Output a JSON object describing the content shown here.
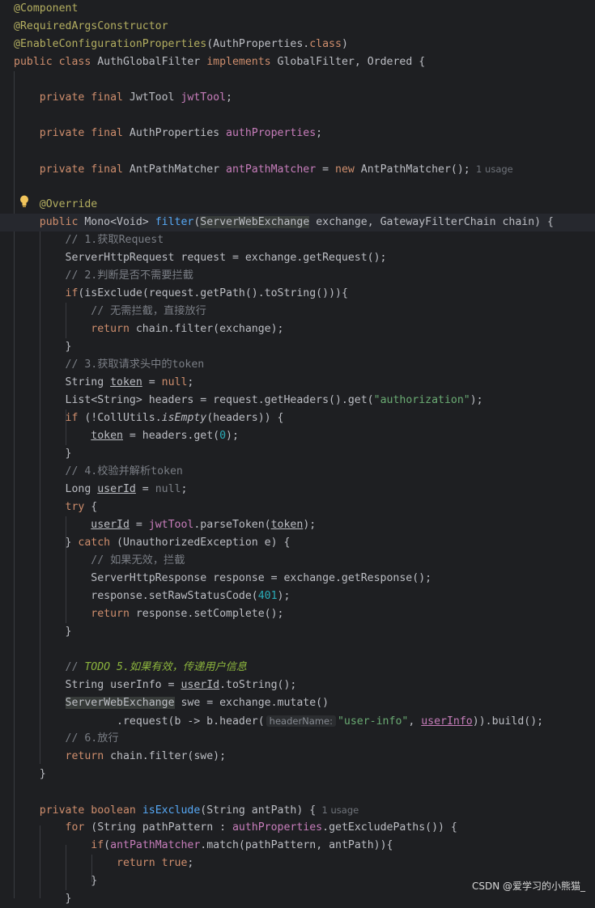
{
  "editor": {
    "lines": [
      [
        {
          "t": "@Component",
          "c": "ann"
        }
      ],
      [
        {
          "t": "@RequiredArgsConstructor",
          "c": "ann"
        }
      ],
      [
        {
          "t": "@EnableConfigurationProperties",
          "c": "ann"
        },
        {
          "t": "(AuthProperties."
        },
        {
          "t": "class",
          "c": "kw"
        },
        {
          "t": ")"
        }
      ],
      [
        {
          "t": "public class ",
          "c": "kw"
        },
        {
          "t": "AuthGlobalFilter "
        },
        {
          "t": "implements ",
          "c": "kw"
        },
        {
          "t": "GlobalFilter, Ordered {"
        }
      ],
      [],
      [
        {
          "t": "    "
        },
        {
          "t": "private final ",
          "c": "kw"
        },
        {
          "t": "JwtTool "
        },
        {
          "t": "jwtTool",
          "c": "fld"
        },
        {
          "t": ";"
        }
      ],
      [],
      [
        {
          "t": "    "
        },
        {
          "t": "private final ",
          "c": "kw"
        },
        {
          "t": "AuthProperties "
        },
        {
          "t": "authProperties",
          "c": "fld"
        },
        {
          "t": ";"
        }
      ],
      [],
      [
        {
          "t": "    "
        },
        {
          "t": "private final ",
          "c": "kw"
        },
        {
          "t": "AntPathMatcher "
        },
        {
          "t": "antPathMatcher",
          "c": "fld"
        },
        {
          "t": " = "
        },
        {
          "t": "new ",
          "c": "kw"
        },
        {
          "t": "AntPathMatcher();"
        },
        {
          "t": "  1 usage",
          "c": "hint"
        }
      ],
      [],
      [
        {
          "t": "    "
        },
        {
          "t": "@Override",
          "c": "ann"
        }
      ],
      [
        {
          "t": "    "
        },
        {
          "t": "public ",
          "c": "kw"
        },
        {
          "t": "Mono<Void> "
        },
        {
          "t": "filter",
          "c": "fn"
        },
        {
          "t": "("
        },
        {
          "t": "ServerWebExchange",
          "c": "hlbg"
        },
        {
          "t": " exchange, GatewayFilterChain chain) {"
        }
      ],
      [
        {
          "t": "        "
        },
        {
          "t": "// 1.获取Request",
          "c": "cmt"
        }
      ],
      [
        {
          "t": "        ServerHttpRequest request = exchange.getRequest();"
        }
      ],
      [
        {
          "t": "        "
        },
        {
          "t": "// 2.判断是否不需要拦截",
          "c": "cmt"
        }
      ],
      [
        {
          "t": "        "
        },
        {
          "t": "if",
          "c": "kw"
        },
        {
          "t": "(isExclude(request.getPath().toString())){"
        }
      ],
      [
        {
          "t": "            "
        },
        {
          "t": "// 无需拦截，直接放行",
          "c": "cmt"
        }
      ],
      [
        {
          "t": "            "
        },
        {
          "t": "return ",
          "c": "kw"
        },
        {
          "t": "chain.filter(exchange);"
        }
      ],
      [
        {
          "t": "        }"
        }
      ],
      [
        {
          "t": "        "
        },
        {
          "t": "// 3.获取请求头中的token",
          "c": "cmt"
        }
      ],
      [
        {
          "t": "        String "
        },
        {
          "t": "token",
          "c": "ul"
        },
        {
          "t": " = "
        },
        {
          "t": "null",
          "c": "kw"
        },
        {
          "t": ";"
        }
      ],
      [
        {
          "t": "        List<String> headers = request.getHeaders().get("
        },
        {
          "t": "\"authorization\"",
          "c": "str"
        },
        {
          "t": ");"
        }
      ],
      [
        {
          "t": "        "
        },
        {
          "t": "if ",
          "c": "kw"
        },
        {
          "t": "(!CollUtils."
        },
        {
          "t": "isEmpty",
          "c": "it"
        },
        {
          "t": "(headers)) {"
        }
      ],
      [
        {
          "t": "            "
        },
        {
          "t": "token",
          "c": "ul"
        },
        {
          "t": " = headers.get("
        },
        {
          "t": "0",
          "c": "num"
        },
        {
          "t": ");"
        }
      ],
      [
        {
          "t": "        }"
        }
      ],
      [
        {
          "t": "        "
        },
        {
          "t": "// 4.校验并解析token",
          "c": "cmt"
        }
      ],
      [
        {
          "t": "        Long "
        },
        {
          "t": "userId",
          "c": "ul"
        },
        {
          "t": " = "
        },
        {
          "t": "null",
          "c": "cmt"
        },
        {
          "t": ";"
        }
      ],
      [
        {
          "t": "        "
        },
        {
          "t": "try ",
          "c": "kw"
        },
        {
          "t": "{"
        }
      ],
      [
        {
          "t": "            "
        },
        {
          "t": "userId",
          "c": "ul"
        },
        {
          "t": " = "
        },
        {
          "t": "jwtTool",
          "c": "fld"
        },
        {
          "t": ".parseToken("
        },
        {
          "t": "token",
          "c": "ul"
        },
        {
          "t": ");"
        }
      ],
      [
        {
          "t": "        } "
        },
        {
          "t": "catch ",
          "c": "kw"
        },
        {
          "t": "(UnauthorizedException e) {"
        }
      ],
      [
        {
          "t": "            "
        },
        {
          "t": "// 如果无效，拦截",
          "c": "cmt"
        }
      ],
      [
        {
          "t": "            ServerHttpResponse response = exchange.getResponse();"
        }
      ],
      [
        {
          "t": "            response.setRawStatusCode("
        },
        {
          "t": "401",
          "c": "num"
        },
        {
          "t": ");"
        }
      ],
      [
        {
          "t": "            "
        },
        {
          "t": "return ",
          "c": "kw"
        },
        {
          "t": "response.setComplete();"
        }
      ],
      [
        {
          "t": "        }"
        }
      ],
      [],
      [
        {
          "t": "        "
        },
        {
          "t": "// ",
          "c": "cmt"
        },
        {
          "t": "TODO 5.如果有效，传递用户信息",
          "c": "todo"
        }
      ],
      [
        {
          "t": "        String userInfo = "
        },
        {
          "t": "userId",
          "c": "ul"
        },
        {
          "t": ".toString();"
        }
      ],
      [
        {
          "t": "        "
        },
        {
          "t": "ServerWebExchange",
          "c": "hlbg"
        },
        {
          "t": " swe = exchange.mutate()"
        }
      ],
      [
        {
          "t": "                .request(b -> b.header("
        },
        {
          "t": "headerName:",
          "c": "param-hint"
        },
        {
          "t": "\"user-info\"",
          "c": "str"
        },
        {
          "t": ", "
        },
        {
          "t": "userInfo",
          "c": "fld ul"
        },
        {
          "t": ")).build();"
        }
      ],
      [
        {
          "t": "        "
        },
        {
          "t": "// 6.放行",
          "c": "cmt"
        }
      ],
      [
        {
          "t": "        "
        },
        {
          "t": "return ",
          "c": "kw"
        },
        {
          "t": "chain.filter(swe);"
        }
      ],
      [
        {
          "t": "    }"
        }
      ],
      [],
      [
        {
          "t": "    "
        },
        {
          "t": "private boolean ",
          "c": "kw"
        },
        {
          "t": "isExclude",
          "c": "fn"
        },
        {
          "t": "(String antPath) {"
        },
        {
          "t": "  1 usage",
          "c": "hint"
        }
      ],
      [
        {
          "t": "        "
        },
        {
          "t": "for ",
          "c": "kw"
        },
        {
          "t": "(String pathPattern : "
        },
        {
          "t": "authProperties",
          "c": "fld"
        },
        {
          "t": ".getExcludePaths()) {"
        }
      ],
      [
        {
          "t": "            "
        },
        {
          "t": "if",
          "c": "kw"
        },
        {
          "t": "("
        },
        {
          "t": "antPathMatcher",
          "c": "fld"
        },
        {
          "t": ".match(pathPattern, antPath)){"
        }
      ],
      [
        {
          "t": "                "
        },
        {
          "t": "return true",
          "c": "kw"
        },
        {
          "t": ";"
        }
      ],
      [
        {
          "t": "            }"
        }
      ],
      [
        {
          "t": "        }"
        }
      ]
    ]
  },
  "watermark": "CSDN @爱学习的小熊猫_",
  "icons": {
    "gutter": "lightbulb-icon"
  }
}
